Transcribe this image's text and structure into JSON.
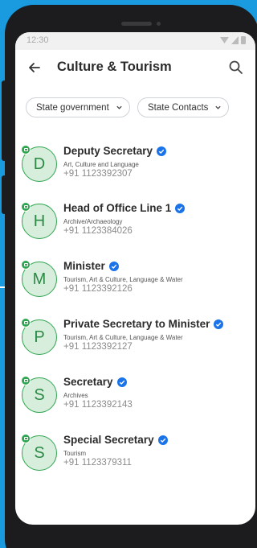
{
  "status_bar": {
    "time": "12:30"
  },
  "header": {
    "title": "Culture & Tourism"
  },
  "filters": [
    {
      "label": "State government"
    },
    {
      "label": "State Contacts"
    }
  ],
  "colors": {
    "accent": "#2ea64f",
    "verified": "#1a73e8",
    "background": "#1a9be0"
  },
  "contacts": [
    {
      "initial": "D",
      "name": "Deputy Secretary",
      "department": "Art, Culture and Language",
      "phone": "+91 1123392307"
    },
    {
      "initial": "H",
      "name": "Head of Office Line 1",
      "department": "Archive/Archaeology",
      "phone": "+91 1123384026"
    },
    {
      "initial": "M",
      "name": "Minister",
      "department": "Tourism, Art & Culture, Language & Water",
      "phone": "+91 1123392126"
    },
    {
      "initial": "P",
      "name": "Private Secretary to Minister",
      "department": "Tourism, Art & Culture, Language & Water",
      "phone": "+91 1123392127"
    },
    {
      "initial": "S",
      "name": "Secretary",
      "department": "Archives",
      "phone": "+91 1123392143"
    },
    {
      "initial": "S",
      "name": "Special Secretary",
      "department": "Tourism",
      "phone": "+91 1123379311"
    }
  ]
}
